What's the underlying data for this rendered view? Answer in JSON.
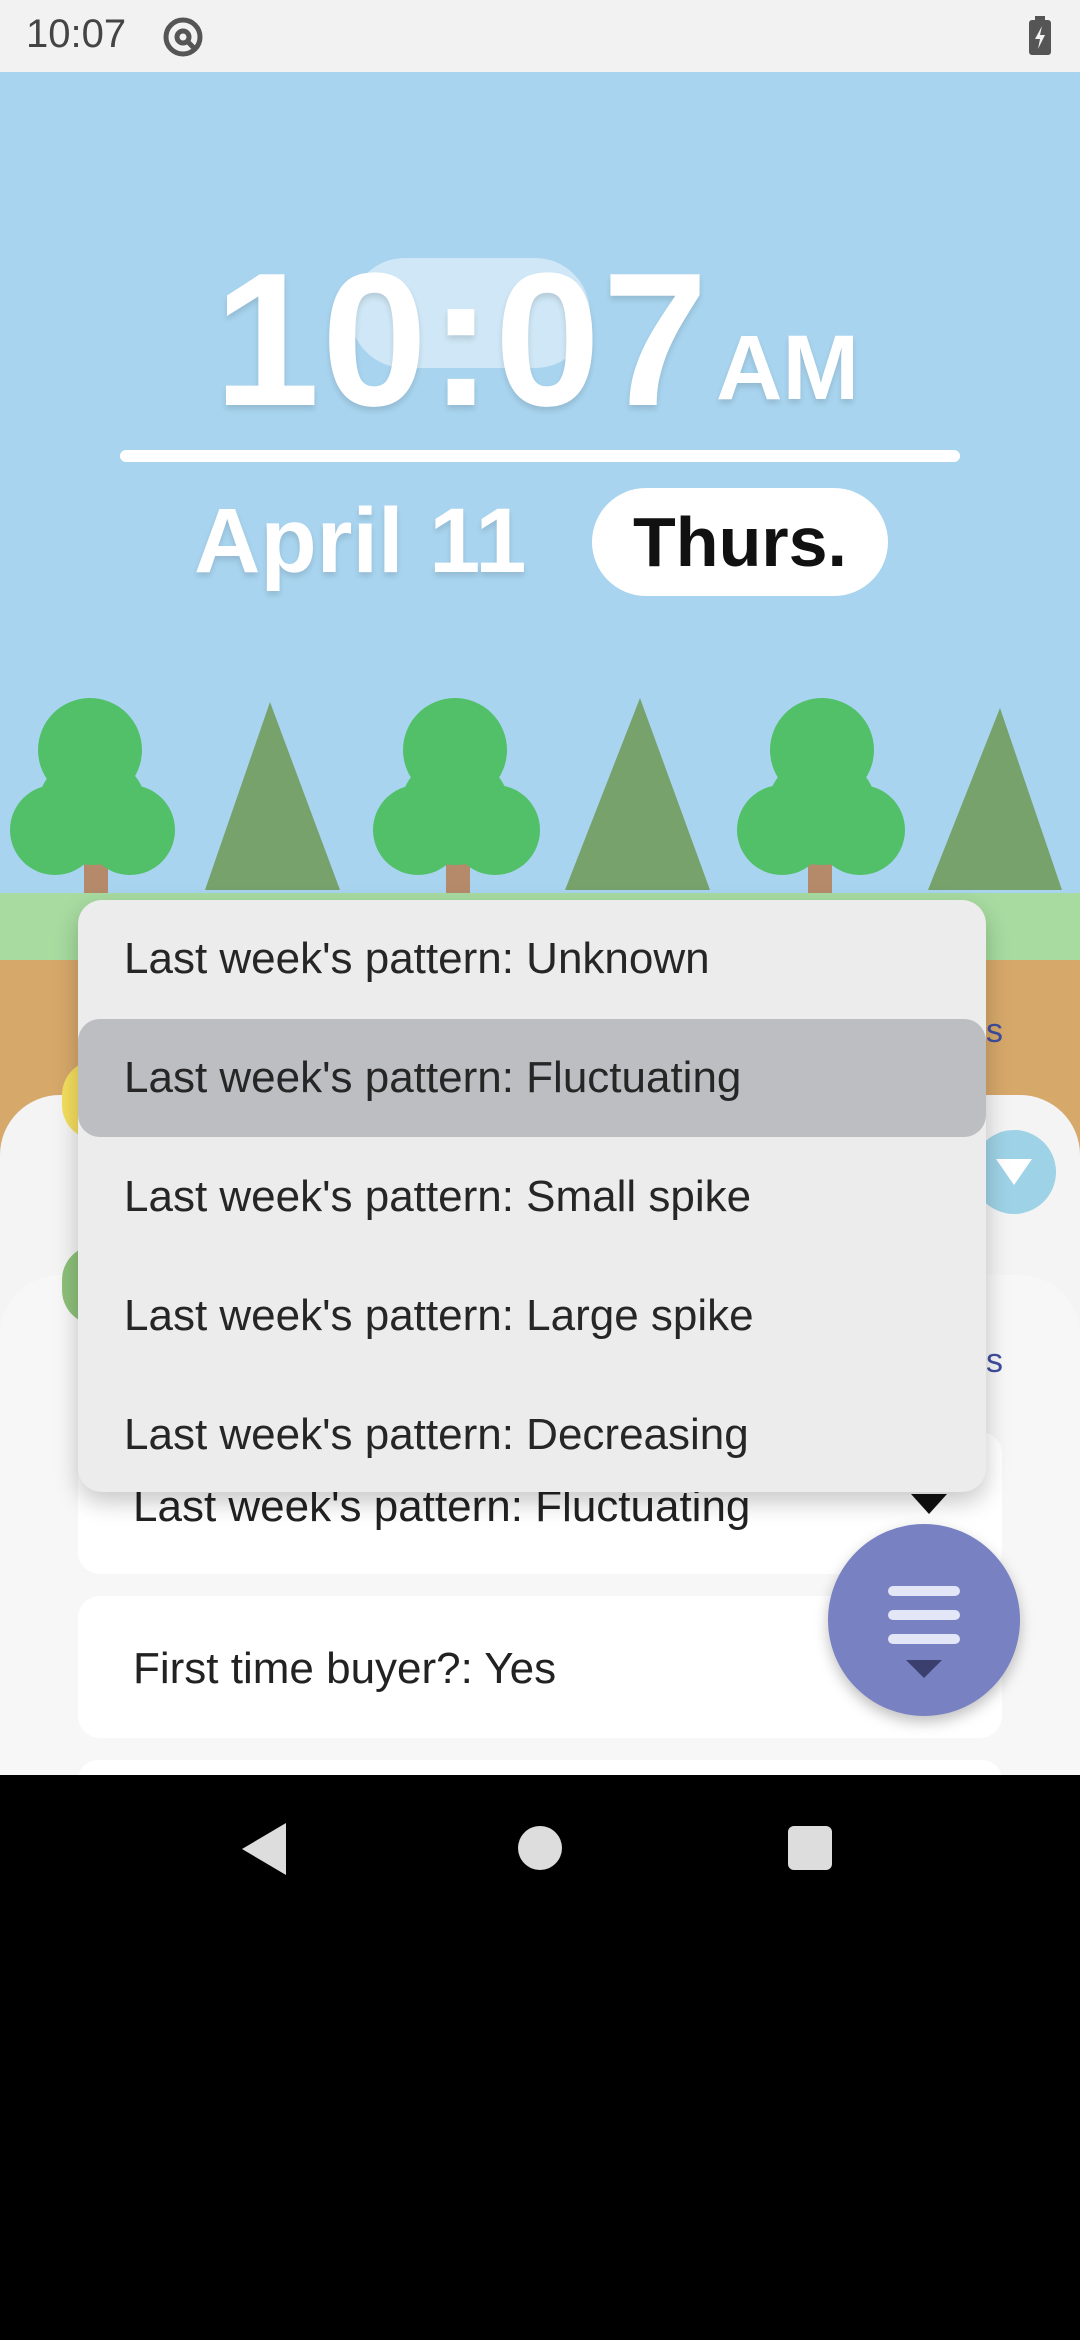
{
  "status_bar": {
    "time": "10:07",
    "left_icon": "at-sign-icon",
    "right_icon": "battery-charging-icon"
  },
  "clock": {
    "time": "10:07",
    "ampm": "AM",
    "date": "April 11",
    "weekday": "Thurs."
  },
  "background_cards": {
    "link_fragment": "s",
    "pattern_label": "Last week's pattern: Fluctuating",
    "buyer_label": "First time buyer?: Yes"
  },
  "dropdown": {
    "options": [
      "Last week's pattern: Unknown",
      "Last week's pattern: Fluctuating",
      "Last week's pattern: Small spike",
      "Last week's pattern: Large spike",
      "Last week's pattern: Decreasing"
    ],
    "selected_index": 1
  },
  "fab": {
    "icon": "filter-menu-icon"
  },
  "nav_bar": {
    "back_icon": "back-triangle-icon",
    "home_icon": "home-circle-icon",
    "recents_icon": "recents-square-icon"
  },
  "colors": {
    "sky": "#a8d4ef",
    "tree_round": "#52c068",
    "tree_pine": "#77a26c",
    "fab": "#7882c2",
    "menu_bg": "#ececec",
    "menu_selected": "#bdbec1"
  }
}
